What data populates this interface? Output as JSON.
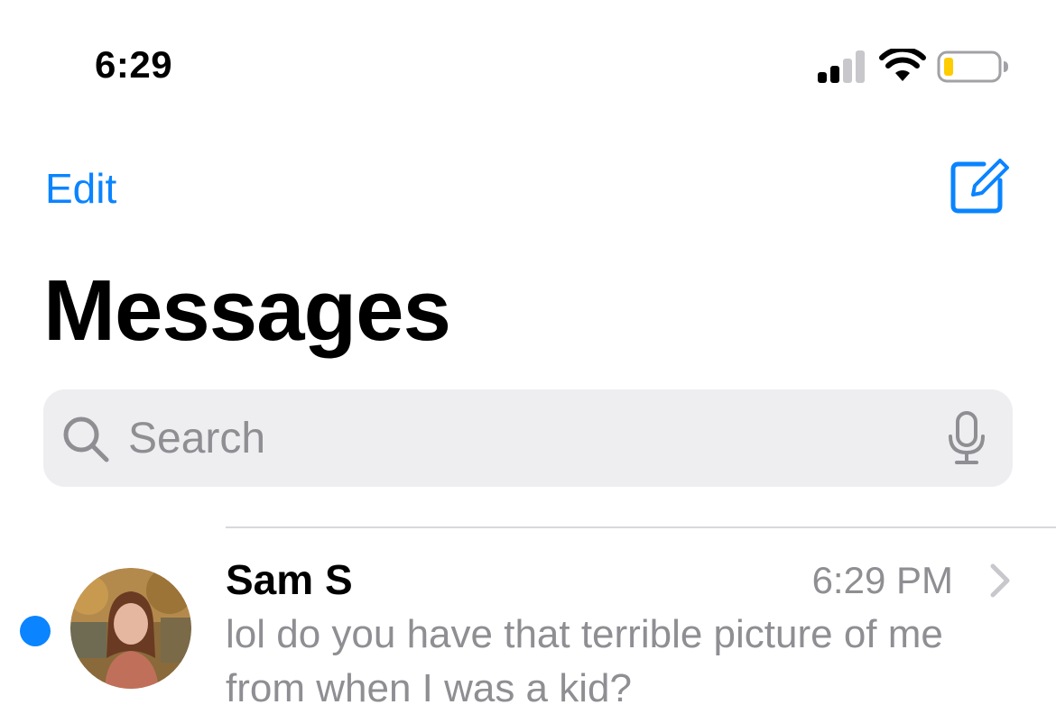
{
  "status_bar": {
    "time": "6:29",
    "signal_icon": "cellular-signal-icon",
    "wifi_icon": "wifi-icon",
    "battery_icon": "battery-low-icon",
    "battery_fill_color": "#ffcc00"
  },
  "nav": {
    "edit_label": "Edit",
    "compose_icon": "compose-icon"
  },
  "title": "Messages",
  "search": {
    "placeholder": "Search",
    "search_icon": "magnifier-icon",
    "mic_icon": "microphone-icon"
  },
  "conversations": [
    {
      "name": "Sam S",
      "time": "6:29 PM",
      "preview": "lol do you have that terrible picture of me from when I was a kid?",
      "unread": true,
      "avatar_icon": "contact-photo"
    }
  ],
  "colors": {
    "accent": "#0a84ff",
    "secondary_text": "#8e8e93",
    "search_bg": "#eeeef0"
  }
}
